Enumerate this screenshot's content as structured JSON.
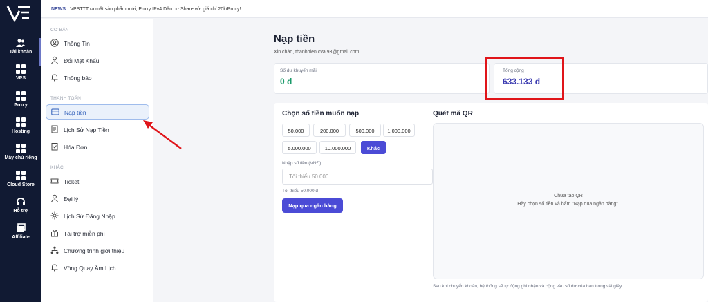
{
  "news": {
    "label": "NEWS:",
    "text": "VPSTTT ra mắt sản phẩm mới, Proxy IPv4 Dân cư Share với giá chỉ 20k/Proxy!"
  },
  "rail": {
    "items": [
      {
        "label": "Tài khoản",
        "icon": "users-icon"
      },
      {
        "label": "VPS",
        "icon": "grid-icon"
      },
      {
        "label": "Proxy",
        "icon": "grid-icon"
      },
      {
        "label": "Hosting",
        "icon": "grid-icon"
      },
      {
        "label": "Máy chủ riêng",
        "icon": "grid-icon"
      },
      {
        "label": "Cloud Store",
        "icon": "grid-icon"
      },
      {
        "label": "Hỗ trợ",
        "icon": "support-icon"
      },
      {
        "label": "Affiliate",
        "icon": "window-icon"
      }
    ]
  },
  "sidebar": {
    "sections": {
      "basic": "CƠ BẢN",
      "payment": "THANH TOÁN",
      "other": "KHÁC"
    },
    "items": [
      {
        "label": "Thông Tin",
        "icon": "user-icon"
      },
      {
        "label": "Đổi Mật Khẩu",
        "icon": "lock-icon"
      },
      {
        "label": "Thông báo",
        "icon": "bell-icon"
      },
      {
        "label": "Nạp tiền",
        "icon": "card-icon"
      },
      {
        "label": "Lịch Sử Nạp Tiền",
        "icon": "history-icon"
      },
      {
        "label": "Hóa Đơn",
        "icon": "invoice-icon"
      },
      {
        "label": "Ticket",
        "icon": "ticket-icon"
      },
      {
        "label": "Đại lý",
        "icon": "agent-icon"
      },
      {
        "label": "Lịch Sử Đăng Nhập",
        "icon": "login-history-icon"
      },
      {
        "label": "Tài trợ miễn phí",
        "icon": "gift-icon"
      },
      {
        "label": "Chương trình giới thiệu",
        "icon": "referral-icon"
      },
      {
        "label": "Vòng Quay Âm Lịch",
        "icon": "wheel-icon"
      }
    ]
  },
  "page": {
    "title": "Nạp tiền",
    "greeting": "Xin chào, thanhhien.cva.93@gmail.com",
    "promo_caption": "Số dư khuyến mãi",
    "promo_value": "0 đ",
    "total_caption": "Tổng cộng",
    "total_value": "633.133 đ",
    "promo_color": "#1a9a6a",
    "total_color": "#3a3ab0"
  },
  "topup": {
    "heading": "Chọn số tiền muốn nạp",
    "amounts": [
      "50.000",
      "200.000",
      "500.000",
      "1.000.000",
      "5.000.000",
      "10.000.000",
      "Khác"
    ],
    "selected": "Khác",
    "input_label": "Nhập số tiền (VNĐ)",
    "input_placeholder": "Tối thiểu 50.000",
    "min_note": "Tối thiểu 50.000 đ",
    "button": "Nạp qua ngân hàng"
  },
  "qr": {
    "heading": "Quét mã QR",
    "empty_title": "Chưa tạo QR",
    "empty_hint": "Hãy chọn số tiền và bấm \"Nạp qua ngân hàng\".",
    "footer": "Sau khi chuyển khoản, hệ thống sẽ tự động ghi nhận và cộng vào số dư của bạn trong vài giây."
  }
}
